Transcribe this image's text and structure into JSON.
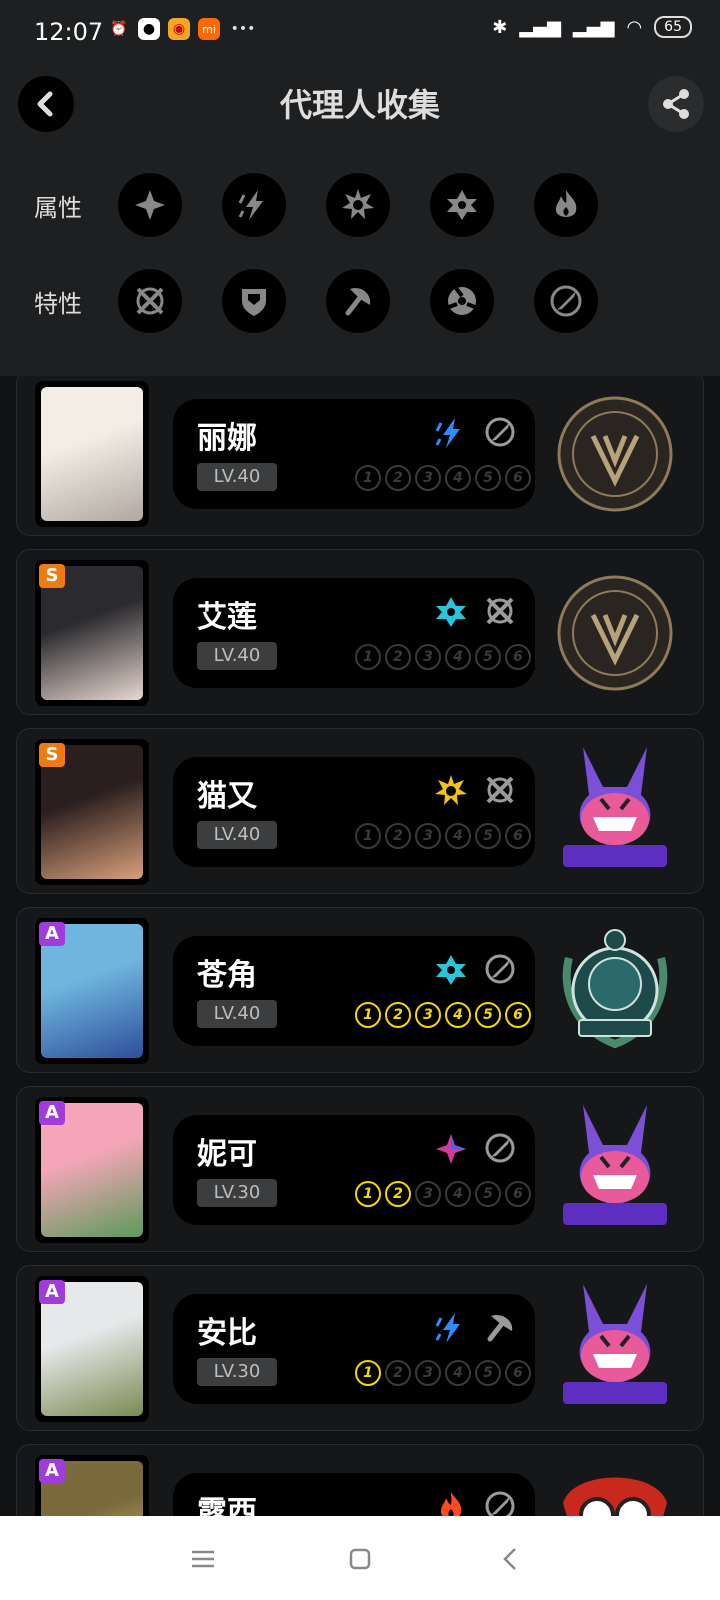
{
  "status_bar": {
    "time": "12:07",
    "battery": "65"
  },
  "header": {
    "title": "代理人收集"
  },
  "filters": {
    "attribute_label": "属性",
    "attribute_icons": [
      "physical-icon",
      "electric-icon",
      "fire-burst-icon",
      "ice-star-icon",
      "fire-icon"
    ],
    "trait_label": "特性",
    "trait_icons": [
      "attack-icon",
      "defense-icon",
      "anomaly-icon",
      "support-icon",
      "stun-icon"
    ]
  },
  "agents": [
    {
      "name": "丽娜",
      "level": "LV.40",
      "rank": "",
      "attribute": "electric",
      "trait": "support",
      "cinema": 0,
      "faction": "victoria"
    },
    {
      "name": "艾莲",
      "level": "LV.40",
      "rank": "S",
      "attribute": "ice",
      "trait": "attack",
      "cinema": 0,
      "faction": "victoria"
    },
    {
      "name": "猫又",
      "level": "LV.40",
      "rank": "S",
      "attribute": "physical",
      "trait": "attack",
      "cinema": 0,
      "faction": "gentle-house"
    },
    {
      "name": "苍角",
      "level": "LV.40",
      "rank": "A",
      "attribute": "ice",
      "trait": "support",
      "cinema": 6,
      "faction": "hsos6"
    },
    {
      "name": "妮可",
      "level": "LV.30",
      "rank": "A",
      "attribute": "ether",
      "trait": "support",
      "cinema": 2,
      "faction": "gentle-house"
    },
    {
      "name": "安比",
      "level": "LV.30",
      "rank": "A",
      "attribute": "electric",
      "trait": "stun",
      "cinema": 1,
      "faction": "gentle-house"
    },
    {
      "name": "露西",
      "level": "",
      "rank": "A",
      "attribute": "fire",
      "trait": "support",
      "cinema": 0,
      "faction": "calydon"
    }
  ],
  "cinema_numbers": [
    "1",
    "2",
    "3",
    "4",
    "5",
    "6"
  ],
  "colors": {
    "rank_s": "#f07a12",
    "rank_a": "#a13bdb",
    "cinema_on": "#f5d800",
    "electric": "#2f8cff",
    "ice": "#27c6da",
    "physical": "#f2c11b",
    "ether": "#d23a9a",
    "fire": "#ff4a1e"
  }
}
